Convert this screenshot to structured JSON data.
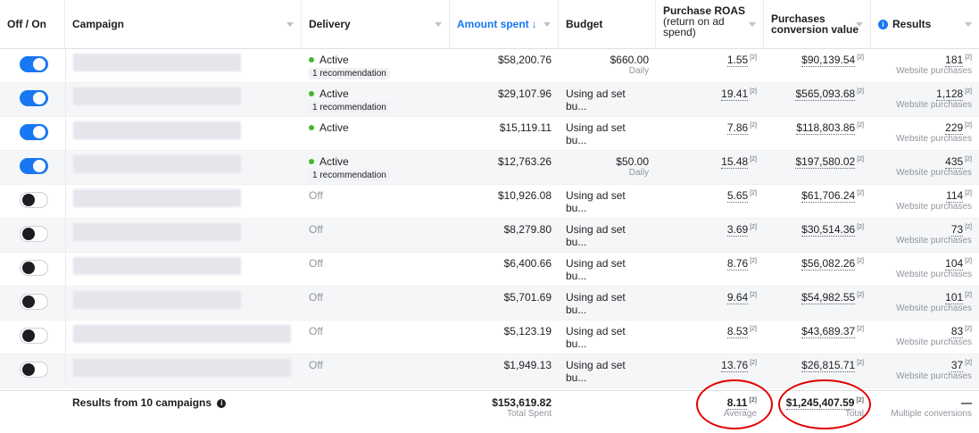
{
  "columns": {
    "toggle": "Off / On",
    "campaign": "Campaign",
    "delivery": "Delivery",
    "amount_spent": "Amount spent",
    "amount_spent_arrow": "↓",
    "budget": "Budget",
    "roas_1": "Purchase ROAS",
    "roas_2": "(return on ad",
    "roas_3": "spend)",
    "pcv_1": "Purchases",
    "pcv_2": "conversion value",
    "results": "Results"
  },
  "rows": [
    {
      "on": true,
      "status": "Active",
      "recommendation": "1 recommendation",
      "spent": "$58,200.76",
      "budget": "$660.00",
      "budget_sub": "Daily",
      "roas": "1.55",
      "pcv": "$90,139.54",
      "results": "181",
      "results_sub": "Website purchases"
    },
    {
      "on": true,
      "status": "Active",
      "recommendation": "1 recommendation",
      "spent": "$29,107.96",
      "budget": "Using ad set bu...",
      "budget_sub": "",
      "roas": "19.41",
      "pcv": "$565,093.68",
      "results": "1,128",
      "results_sub": "Website purchases"
    },
    {
      "on": true,
      "status": "Active",
      "recommendation": "",
      "spent": "$15,119.11",
      "budget": "Using ad set bu...",
      "budget_sub": "",
      "roas": "7.86",
      "pcv": "$118,803.86",
      "results": "229",
      "results_sub": "Website purchases"
    },
    {
      "on": true,
      "status": "Active",
      "recommendation": "1 recommendation",
      "spent": "$12,763.26",
      "budget": "$50.00",
      "budget_sub": "Daily",
      "roas": "15.48",
      "pcv": "$197,580.02",
      "results": "435",
      "results_sub": "Website purchases"
    },
    {
      "on": false,
      "status": "Off",
      "recommendation": "",
      "spent": "$10,926.08",
      "budget": "Using ad set bu...",
      "budget_sub": "",
      "roas": "5.65",
      "pcv": "$61,706.24",
      "results": "114",
      "results_sub": "Website purchases"
    },
    {
      "on": false,
      "status": "Off",
      "recommendation": "",
      "spent": "$8,279.80",
      "budget": "Using ad set bu...",
      "budget_sub": "",
      "roas": "3.69",
      "pcv": "$30,514.36",
      "results": "73",
      "results_sub": "Website purchases"
    },
    {
      "on": false,
      "status": "Off",
      "recommendation": "",
      "spent": "$6,400.66",
      "budget": "Using ad set bu...",
      "budget_sub": "",
      "roas": "8.76",
      "pcv": "$56,082.26",
      "results": "104",
      "results_sub": "Website purchases"
    },
    {
      "on": false,
      "status": "Off",
      "recommendation": "",
      "spent": "$5,701.69",
      "budget": "Using ad set bu...",
      "budget_sub": "",
      "roas": "9.64",
      "pcv": "$54,982.55",
      "results": "101",
      "results_sub": "Website purchases"
    },
    {
      "on": false,
      "status": "Off",
      "recommendation": "",
      "spent": "$5,123.19",
      "budget": "Using ad set bu...",
      "budget_sub": "",
      "roas": "8.53",
      "pcv": "$43,689.37",
      "results": "83",
      "results_sub": "Website purchases"
    },
    {
      "on": false,
      "status": "Off",
      "recommendation": "",
      "spent": "$1,949.13",
      "budget": "Using ad set bu...",
      "budget_sub": "",
      "roas": "13.76",
      "pcv": "$26,815.71",
      "results": "37",
      "results_sub": "Website purchases"
    }
  ],
  "attribution_marker": "[2]",
  "totals": {
    "label": "Results from 10 campaigns",
    "spent": "$153,619.82",
    "spent_sub": "Total Spent",
    "roas": "8.11",
    "roas_sub": "Average",
    "pcv": "$1,245,407.59",
    "pcv_sub": "Total",
    "results": "—",
    "results_sub": "Multiple conversions"
  },
  "colors": {
    "accent": "#1877f2",
    "active_dot": "#42b72a",
    "annotation_circle": "#e00000"
  }
}
